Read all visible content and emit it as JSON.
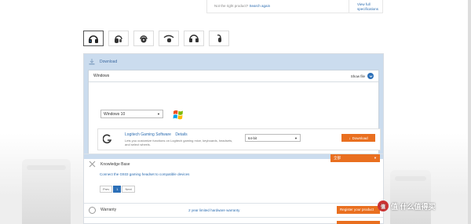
{
  "top": {
    "hint_text": "Not the right product?",
    "hint_link": "Search again",
    "view_full": "View full specifications"
  },
  "thumbnails": [
    "headset-1-icon",
    "headset-2-icon",
    "headset-3-icon",
    "headset-4-icon",
    "headset-5-icon",
    "headset-6-icon"
  ],
  "download": {
    "title": "Download",
    "os_bar_label": "Windows",
    "show_file": "Show file",
    "os_select_value": "Windows 10",
    "software": {
      "name": "Logitech Gaming Software",
      "details": "Details",
      "description": "Lets you customize functions on Logitech gaming mice, keyboards, headsets, and select wheels.",
      "bit_select_value": "64-bit",
      "download_button": "Download"
    }
  },
  "knowledge_base": {
    "title": "Knowledge Base",
    "select_value": "全部",
    "article_link": "Connect the G933 gaming headset to compatible devices",
    "pager": {
      "prev": "Prev",
      "current": "1",
      "next": "Next"
    }
  },
  "warranty": {
    "title": "Warranty",
    "link": "2 year limited hardware warranty",
    "register_button": "Register your product"
  },
  "watermark": {
    "text": "值 什么值得买",
    "badge": "值"
  },
  "colors": {
    "accent_orange": "#e96f1f",
    "panel_blue": "#cbdcee",
    "link_blue": "#2b6cb0"
  }
}
